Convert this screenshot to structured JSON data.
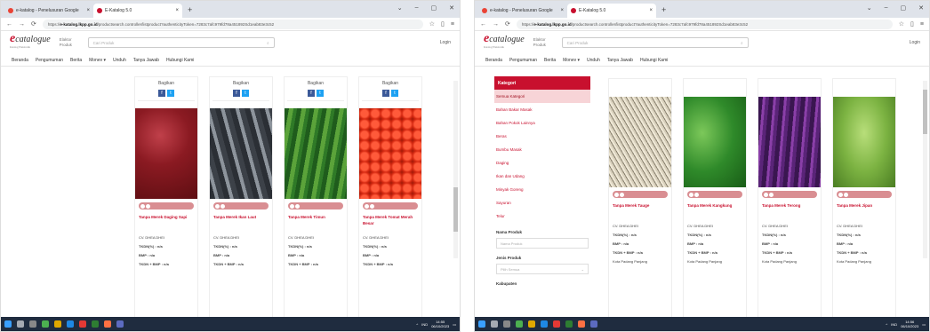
{
  "left": {
    "tabs": [
      {
        "label": "e-katalog - Penelusuran Google",
        "active": false
      },
      {
        "label": "E-Katalog 5.0",
        "active": true
      }
    ],
    "url": {
      "host": "e-katalog.lkpp.go.id",
      "path": "/productsearch.controller/listproduct?authenticityToken=7283c7afc979fd78a451892Sd1eab83e3c52"
    },
    "header": {
      "logo_e": "e",
      "logo_text": "catalogue",
      "logo_sub": "Katalog Elektronik",
      "ekatalog": "Elaktor Produk",
      "search_placeholder": "Cari Produk",
      "login": "Login"
    },
    "nav": [
      "Beranda",
      "Pengumuman",
      "Berita",
      "Monev ▾",
      "Unduh",
      "Tanya Jawab",
      "Hubungi Kami"
    ],
    "cards": [
      {
        "share": "Bagikan",
        "name": "Tanpa Merek Daging Sapi",
        "seller": "CV. DHEA DHEI",
        "tkdn": "TKDN(%) : n/a",
        "bmp": "BMP : n/a",
        "tkdnbmp": "TKDN + BMP : n/a",
        "img": "meat"
      },
      {
        "share": "Bagikan",
        "name": "Tanpa Merek Ikan Laut",
        "seller": "CV. DHEA DHEI",
        "tkdn": "TKDN(%) : n/a",
        "bmp": "BMP : n/a",
        "tkdnbmp": "TKDN + BMP : n/a",
        "img": "fish"
      },
      {
        "share": "Bagikan",
        "name": "Tanpa Merek Timun",
        "seller": "CV. DHEA DHEI",
        "tkdn": "TKDN(%) : n/a",
        "bmp": "BMP : n/a",
        "tkdnbmp": "TKDN + BMP : n/a",
        "img": "cucumber"
      },
      {
        "share": "Bagikan",
        "name": "Tanpa Merek Tomat Merah Besar",
        "seller": "CV. DHEA DHEI",
        "tkdn": "TKDN(%) : n/a",
        "bmp": "BMP : n/a",
        "tkdnbmp": "TKDN + BMP : n/a",
        "img": "tomato"
      }
    ],
    "clock": {
      "time": "14:55",
      "date": "06/10/2023",
      "lang": "IND"
    }
  },
  "right": {
    "tabs": [
      {
        "label": "e-katalog - Penelusuran Google",
        "active": false
      },
      {
        "label": "E-Katalog 5.0",
        "active": true
      }
    ],
    "url": {
      "host": "e-katalog.lkpp.go.id",
      "path": "/productsearch.controller/listproduct?authenticityToken=7283c7afc979fd78a451892Sd1eab83e3c52"
    },
    "header": {
      "logo_e": "e",
      "logo_text": "catalogue",
      "logo_sub": "Katalog Elektronik",
      "ekatalog": "Elaktor Produk",
      "search_placeholder": "Cari Produk",
      "login": "Login"
    },
    "nav": [
      "Beranda",
      "Pengumuman",
      "Berita",
      "Monev ▾",
      "Unduh",
      "Tanya Jawab",
      "Hubungi Kami"
    ],
    "sidebar": {
      "title": "Kategori",
      "items": [
        "Semua Kategori",
        "Bahan Bakar Masak",
        "Bahan Pokok Lainnya",
        "Beras",
        "Bumbu Masak",
        "Daging",
        "Ikan dan Udang",
        "Minyak Goreng",
        "Sayuran",
        "Telur"
      ],
      "selected": 0,
      "nama_label": "Nama Produk",
      "nama_placeholder": "Nama Produk",
      "jenis_label": "Jenis Produk",
      "jenis_value": "Pilih Semua",
      "kab_label": "Kabupaten"
    },
    "cards": [
      {
        "name": "Tanpa Merek Tauge",
        "seller": "CV. DHEA DHEI",
        "tkdn": "TKDN(%) : n/a",
        "bmp": "BMP : n/a",
        "tkdnbmp": "TKDN + BMP : n/a",
        "loc": "Kota Padang Panjang",
        "img": "sprouts"
      },
      {
        "name": "Tanpa Merek Kangkung",
        "seller": "CV. DHEA DHEI",
        "tkdn": "TKDN(%) : n/a",
        "bmp": "BMP : n/a",
        "tkdnbmp": "TKDN + BMP : n/a",
        "loc": "Kota Padang Panjang",
        "img": "kangkung"
      },
      {
        "name": "Tanpa Merek Terong",
        "seller": "CV. DHEA DHEI",
        "tkdn": "TKDN(%) : n/a",
        "bmp": "BMP : n/a",
        "tkdnbmp": "TKDN + BMP : n/a",
        "loc": "Kota Padang Panjang",
        "img": "eggplant"
      },
      {
        "name": "Tanpa Merek Jipan",
        "seller": "CV. DHEA DHEI",
        "tkdn": "TKDN(%) : n/a",
        "bmp": "BMP : n/a",
        "tkdnbmp": "TKDN + BMP : n/a",
        "loc": "Kota Padang Panjang",
        "img": "chayote"
      }
    ],
    "clock": {
      "time": "14:56",
      "date": "06/10/2023",
      "lang": "IND"
    }
  },
  "colors": {
    "brand": "#c8102e",
    "taskbar": "#1f2c3f",
    "facebook": "#3b5998",
    "twitter": "#1da1f2",
    "rating": "#d98e92"
  }
}
